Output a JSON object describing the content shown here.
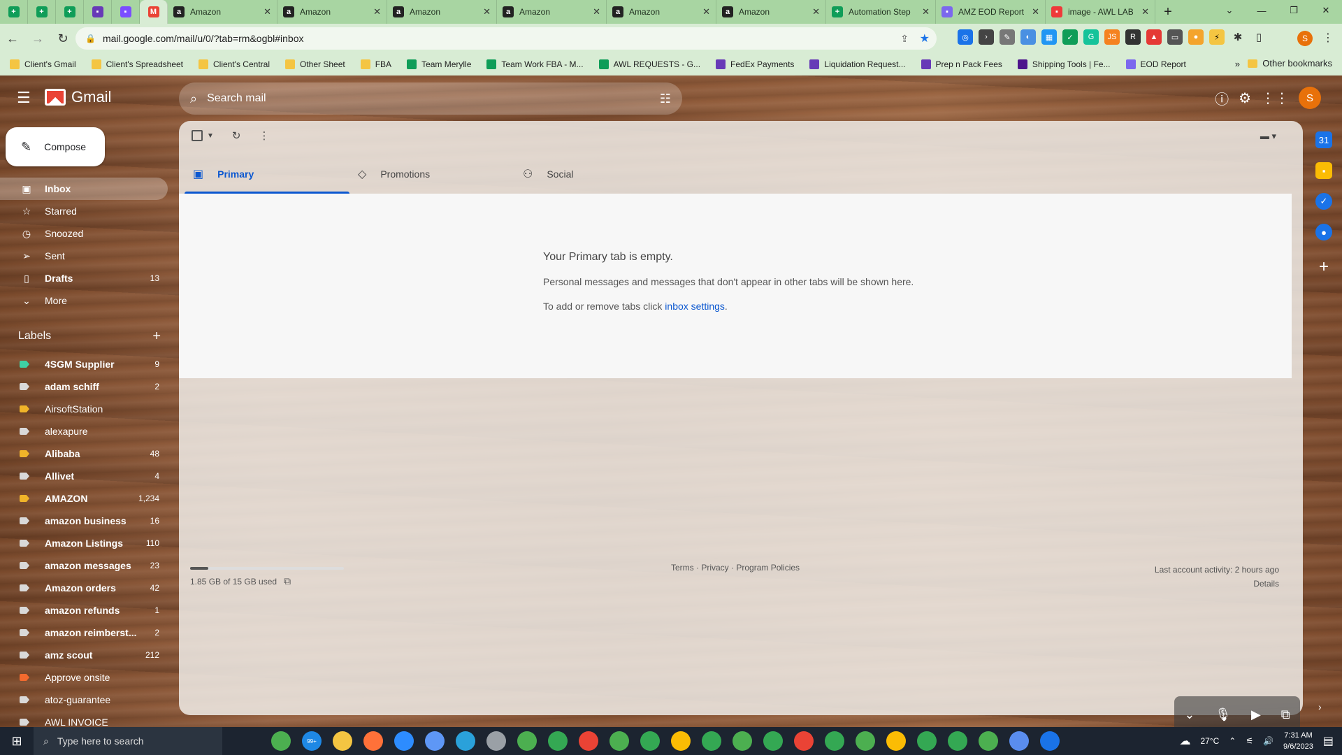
{
  "browser": {
    "tabs": [
      {
        "type": "pinned",
        "icon": "sheets-icon",
        "color": "#0f9d58"
      },
      {
        "type": "pinned",
        "icon": "sheets-icon",
        "color": "#0f9d58"
      },
      {
        "type": "pinned",
        "icon": "sheets-icon",
        "color": "#0f9d58"
      },
      {
        "type": "pinned",
        "icon": "forms-icon",
        "color": "#673ab7"
      },
      {
        "type": "pinned",
        "icon": "messenger-icon",
        "color": "#7b4dff"
      },
      {
        "type": "pinned",
        "icon": "gmail-icon",
        "color": "#ea4335",
        "active": true
      },
      {
        "type": "normal",
        "title": "Amazon",
        "icon": "amazon-icon",
        "color": "#222222"
      },
      {
        "type": "normal",
        "title": "Amazon",
        "icon": "amazon-icon",
        "color": "#222222"
      },
      {
        "type": "normal",
        "title": "Amazon",
        "icon": "amazon-icon",
        "color": "#222222"
      },
      {
        "type": "normal",
        "title": "Amazon",
        "icon": "amazon-icon",
        "color": "#222222"
      },
      {
        "type": "normal",
        "title": "Amazon",
        "icon": "amazon-icon",
        "color": "#222222"
      },
      {
        "type": "normal",
        "title": "Amazon",
        "icon": "amazon-icon",
        "color": "#222222"
      },
      {
        "type": "normal",
        "title": "Automation Step",
        "icon": "sheets-icon",
        "color": "#0f9d58"
      },
      {
        "type": "normal",
        "title": "AMZ EOD Report",
        "icon": "clickup-icon",
        "color": "#7b68ee"
      },
      {
        "type": "normal",
        "title": "image - AWL LAB",
        "icon": "vivaldi-icon",
        "color": "#ef3939"
      }
    ],
    "url": "mail.google.com/mail/u/0/?tab=rm&ogbl#inbox",
    "profile_initial": "S",
    "bookmarks": [
      {
        "label": "Client's Gmail",
        "color": "#f4c542"
      },
      {
        "label": "Client's Spreadsheet",
        "color": "#f4c542"
      },
      {
        "label": "Client's Central",
        "color": "#f4c542"
      },
      {
        "label": "Other Sheet",
        "color": "#f4c542"
      },
      {
        "label": "FBA",
        "color": "#f4c542"
      },
      {
        "label": "Team Merylle",
        "color": "#0f9d58"
      },
      {
        "label": "Team Work FBA - M...",
        "color": "#0f9d58"
      },
      {
        "label": "AWL REQUESTS - G...",
        "color": "#0f9d58"
      },
      {
        "label": "FedEx Payments",
        "color": "#673ab7"
      },
      {
        "label": "Liquidation Request...",
        "color": "#673ab7"
      },
      {
        "label": "Prep n Pack Fees",
        "color": "#673ab7"
      },
      {
        "label": "Shipping Tools | Fe...",
        "color": "#4d148c"
      },
      {
        "label": "EOD Report",
        "color": "#7b68ee"
      }
    ],
    "bookmarks_more": "»",
    "other_bookmarks": "Other bookmarks"
  },
  "gmail": {
    "brand": "Gmail",
    "search_placeholder": "Search mail",
    "avatar_initial": "S",
    "compose_label": "Compose",
    "nav": [
      {
        "label": "Inbox",
        "icon": "inbox-icon",
        "glyph": "▣",
        "count": "",
        "active": true
      },
      {
        "label": "Starred",
        "icon": "star-icon",
        "glyph": "☆",
        "count": ""
      },
      {
        "label": "Snoozed",
        "icon": "clock-icon",
        "glyph": "◷",
        "count": ""
      },
      {
        "label": "Sent",
        "icon": "send-icon",
        "glyph": "➢",
        "count": ""
      },
      {
        "label": "Drafts",
        "icon": "draft-icon",
        "glyph": "▯",
        "count": "13",
        "bold": true
      },
      {
        "label": "More",
        "icon": "chevron-down-icon",
        "glyph": "⌄",
        "count": ""
      }
    ],
    "labels_title": "Labels",
    "labels": [
      {
        "label": "4SGM Supplier",
        "count": "9",
        "color": "#3ed0a4",
        "bold": true
      },
      {
        "label": "adam schiff",
        "count": "2",
        "color": "#d9d9d9",
        "bold": true
      },
      {
        "label": "AirsoftStation",
        "count": "",
        "color": "#f0b429",
        "bold": false
      },
      {
        "label": "alexapure",
        "count": "",
        "color": "#d9d9d9",
        "bold": false
      },
      {
        "label": "Alibaba",
        "count": "48",
        "color": "#f0b429",
        "bold": true
      },
      {
        "label": "Allivet",
        "count": "4",
        "color": "#d9d9d9",
        "bold": true
      },
      {
        "label": "AMAZON",
        "count": "1,234",
        "color": "#f0b429",
        "bold": true
      },
      {
        "label": "amazon business",
        "count": "16",
        "color": "#d9d9d9",
        "bold": true
      },
      {
        "label": "Amazon Listings",
        "count": "110",
        "color": "#d9d9d9",
        "bold": true
      },
      {
        "label": "amazon messages",
        "count": "23",
        "color": "#d9d9d9",
        "bold": true
      },
      {
        "label": "Amazon orders",
        "count": "42",
        "color": "#d9d9d9",
        "bold": true
      },
      {
        "label": "amazon refunds",
        "count": "1",
        "color": "#d9d9d9",
        "bold": true
      },
      {
        "label": "amazon reimberst...",
        "count": "2",
        "color": "#d9d9d9",
        "bold": true
      },
      {
        "label": "amz scout",
        "count": "212",
        "color": "#d9d9d9",
        "bold": true
      },
      {
        "label": "Approve onsite",
        "count": "",
        "color": "#f26a2e",
        "bold": false
      },
      {
        "label": "atoz-guarantee",
        "count": "",
        "color": "#d9d9d9",
        "bold": false
      },
      {
        "label": "AWL INVOICE",
        "count": "",
        "color": "#d9d9d9",
        "bold": false
      }
    ],
    "tabs": [
      {
        "label": "Primary",
        "icon": "inbox-icon",
        "glyph": "▣",
        "active": true
      },
      {
        "label": "Promotions",
        "icon": "tag-icon",
        "glyph": "◇",
        "active": false
      },
      {
        "label": "Social",
        "icon": "people-icon",
        "glyph": "⚇",
        "active": false
      }
    ],
    "empty": {
      "title": "Your Primary tab is empty.",
      "subtitle": "Personal messages and messages that don't appear in other tabs will be shown here.",
      "settings_prefix": "To add or remove tabs click ",
      "settings_link": "inbox settings",
      "settings_suffix": "."
    },
    "footer": {
      "storage": "1.85 GB of 15 GB used",
      "storage_fraction": 0.12,
      "terms": "Terms",
      "privacy": "Privacy",
      "policies": "Program Policies",
      "activity": "Last account activity: 2 hours ago",
      "details": "Details"
    }
  },
  "taskbar": {
    "search_placeholder": "Type here to search",
    "weather": "27°C",
    "time": "7:31 AM",
    "date": "9/6/2023",
    "badge": "99+"
  }
}
